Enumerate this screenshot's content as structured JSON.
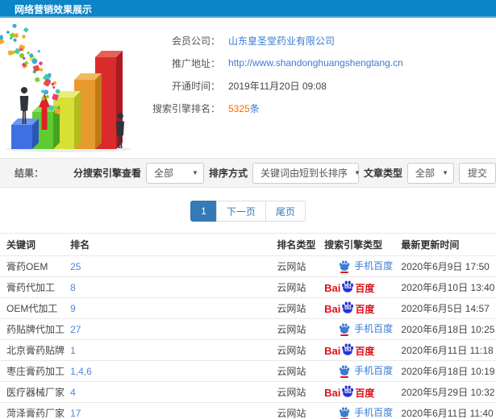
{
  "header": {
    "title": "网络营销效果展示"
  },
  "info": {
    "fields": [
      {
        "label": "会员公司：",
        "value": "山东皇圣堂药业有限公司"
      },
      {
        "label": "推广地址：",
        "value": "http://www.shandonghuangshengtang.cn"
      },
      {
        "label": "开通时间：",
        "value": "2019年11月20日 09:08"
      },
      {
        "label": "搜索引擎排名：",
        "value": "5325",
        "suffix": "条"
      }
    ]
  },
  "filters": {
    "result_label": "结果：",
    "engine_label": "分搜索引擎查看",
    "engine_value": "全部",
    "sort_label": "排序方式",
    "sort_value": "关键词由短到长排序",
    "article_label": "文章类型",
    "article_value": "全部",
    "submit_label": "提交",
    "caret": "▼"
  },
  "pagination": {
    "current": "1",
    "next": "下一页",
    "last": "尾页"
  },
  "table": {
    "headers": [
      "关键词",
      "排名",
      "排名类型",
      "搜索引擎类型",
      "最新更新时间"
    ],
    "baidu_logo": {
      "bai": "Bai",
      "du": "du",
      "cn": "百度"
    },
    "mobile_label": "手机百度",
    "rows": [
      {
        "keyword": "膏药OEM",
        "rank": "25",
        "rank_type": "云网站",
        "engine": "mobile",
        "time": "2020年6月9日 17:50"
      },
      {
        "keyword": "膏药代加工",
        "rank": "8",
        "rank_type": "云网站",
        "engine": "baidu",
        "time": "2020年6月10日 13:40"
      },
      {
        "keyword": "OEM代加工",
        "rank": "9",
        "rank_type": "云网站",
        "engine": "baidu",
        "time": "2020年6月5日 14:57"
      },
      {
        "keyword": "药贴牌代加工",
        "rank": "27",
        "rank_type": "云网站",
        "engine": "mobile",
        "time": "2020年6月18日 10:25"
      },
      {
        "keyword": "北京膏药贴牌",
        "rank": "1",
        "rank_type": "云网站",
        "engine": "baidu",
        "time": "2020年6月11日 11:18"
      },
      {
        "keyword": "枣庄膏药加工",
        "rank": "1,4,6",
        "rank_type": "云网站",
        "engine": "mobile",
        "time": "2020年6月18日 10:19"
      },
      {
        "keyword": "医疗器械厂家",
        "rank": "4",
        "rank_type": "云网站",
        "engine": "baidu",
        "time": "2020年5月29日 10:32"
      },
      {
        "keyword": "菏泽膏药厂家",
        "rank": "17",
        "rank_type": "云网站",
        "engine": "mobile",
        "time": "2020年6月11日 11:40"
      }
    ]
  },
  "colors": {
    "header_bg": "#0b84c8",
    "link_blue": "#3a7bd5",
    "rank_blue": "#4a89dc",
    "highlight_orange": "#ff6600",
    "pagination_active": "#337ab7",
    "baidu_red": "#de0f17",
    "baidu_blue": "#2732d9"
  },
  "illustration": {
    "bars": [
      {
        "front": "#3f6fe3",
        "top": "#6e97ef",
        "side": "#2c55b8",
        "height": 30
      },
      {
        "front": "#5ecb31",
        "top": "#8adf63",
        "side": "#46a31f",
        "height": 46
      },
      {
        "front": "#d9e035",
        "top": "#e9ee78",
        "side": "#b4bb1e",
        "height": 64
      },
      {
        "front": "#e79b2e",
        "top": "#f2b863",
        "side": "#c07a14",
        "height": 86
      },
      {
        "front": "#d92b2b",
        "top": "#e85f5a",
        "side": "#ad1a20",
        "height": 114
      }
    ],
    "confetti_colors": [
      "#e6427e",
      "#36a9e1",
      "#7ed321",
      "#f5a623",
      "#9b59b6",
      "#e74c3c",
      "#f8e71c",
      "#49c8b1"
    ],
    "arrow_color": "#e02128",
    "person_color": "#30333a"
  }
}
